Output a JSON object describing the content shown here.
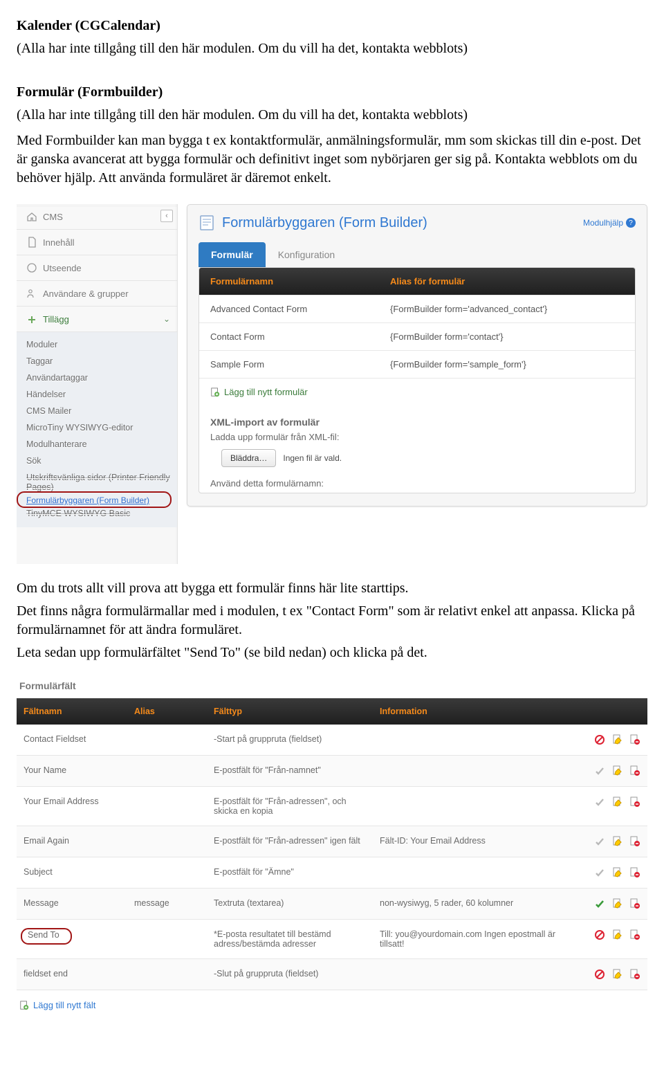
{
  "section1": {
    "heading": "Kalender (CGCalendar)",
    "sub": "(Alla har inte tillgång till den här modulen. Om du vill ha det, kontakta webblots)"
  },
  "section2": {
    "heading": "Formulär (Formbuilder)",
    "sub": "(Alla har inte tillgång till den här modulen. Om du vill ha det, kontakta webblots)",
    "p1": "Med Formbuilder kan man bygga t ex kontaktformulär, anmälningsformulär, mm som skickas till din e-post. Det är ganska avancerat att bygga formulär och definitivt inget som nybörjaren ger sig på. Kontakta webblots om du behöver hjälp. Att använda formuläret är däremot enkelt."
  },
  "sidebar": {
    "sections": {
      "s0": "CMS",
      "s1": "Innehåll",
      "s2": "Utseende",
      "s3": "Användare & grupper",
      "s4": "Tillägg"
    },
    "items": {
      "i0": "Moduler",
      "i1": "Taggar",
      "i2": "Användartaggar",
      "i3": "Händelser",
      "i4": "CMS Mailer",
      "i5": "MicroTiny WYSIWYG-editor",
      "i6": "Modulhanterare",
      "i7": "Sök",
      "i8": "Utskriftsvänliga sidor (Printer Friendly Pages)",
      "i9": "Formulärbyggaren (Form Builder)",
      "i10": "TinyMCE WYSIWYG Basic"
    }
  },
  "fbpanel": {
    "title": "Formulärbyggaren (Form Builder)",
    "help": "Modulhjälp",
    "tabs": {
      "t0": "Formulär",
      "t1": "Konfiguration"
    },
    "th": {
      "name": "Formulärnamn",
      "alias": "Alias för formulär"
    },
    "rows": {
      "r0": {
        "name": "Advanced Contact Form",
        "alias": "{FormBuilder form='advanced_contact'}"
      },
      "r1": {
        "name": "Contact Form",
        "alias": "{FormBuilder form='contact'}"
      },
      "r2": {
        "name": "Sample Form",
        "alias": "{FormBuilder form='sample_form'}"
      }
    },
    "add": "Lägg till nytt formulär",
    "xmlhead": "XML-import av formulär",
    "xmlload": "Ladda upp formulär från XML-fil:",
    "browse": "Bläddra…",
    "nofile": "Ingen fil är vald.",
    "usename": "Använd detta formulärnamn:"
  },
  "para_after": {
    "p1": "Om du trots allt vill prova att bygga ett formulär finns här lite starttips.",
    "p2": "Det finns några formulärmallar med i modulen, t ex \"Contact Form\" som är relativt enkel att anpassa. Klicka på formulärnamnet för att ändra formuläret.",
    "p3": "Leta sedan upp formulärfältet \"Send To\" (se bild nedan) och klicka på det."
  },
  "fftable": {
    "title": "Formulärfält",
    "th": {
      "name": "Fältnamn",
      "alias": "Alias",
      "type": "Fälttyp",
      "info": "Information"
    },
    "rows": {
      "r0": {
        "name": "Contact Fieldset",
        "alias": "",
        "type": "-Start på gruppruta (fieldset)",
        "info": ""
      },
      "r1": {
        "name": "Your Name",
        "alias": "",
        "type": "E-postfält för \"Från-namnet\"",
        "info": ""
      },
      "r2": {
        "name": "Your Email Address",
        "alias": "",
        "type": "E-postfält för \"Från-adressen\", och skicka en kopia",
        "info": ""
      },
      "r3": {
        "name": "Email Again",
        "alias": "",
        "type": "E-postfält för \"Från-adressen\" igen fält",
        "info": "Fält-ID: Your Email Address"
      },
      "r4": {
        "name": "Subject",
        "alias": "",
        "type": "E-postfält för \"Ämne\"",
        "info": ""
      },
      "r5": {
        "name": "Message",
        "alias": "message",
        "type": "Textruta (textarea)",
        "info": "non-wysiwyg, 5 rader, 60 kolumner"
      },
      "r6": {
        "name": "Send To",
        "alias": "",
        "type": "*E-posta resultatet till bestämd adress/bestämda adresser",
        "info": "Till: you@yourdomain.com Ingen epostmall är tillsatt!"
      },
      "r7": {
        "name": "fieldset end",
        "alias": "",
        "type": "-Slut på gruppruta (fieldset)",
        "info": ""
      }
    },
    "add": "Lägg till nytt fält"
  }
}
